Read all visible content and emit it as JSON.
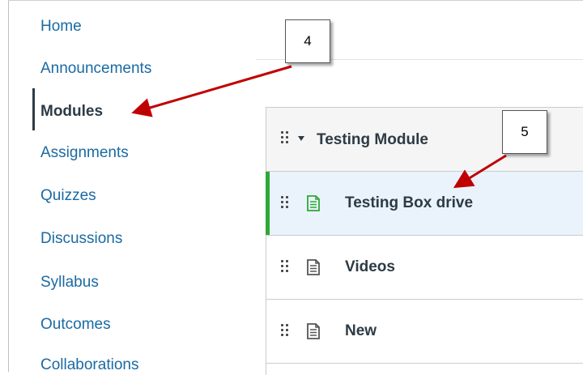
{
  "nav": {
    "items": [
      {
        "label": "Home"
      },
      {
        "label": "Announcements"
      },
      {
        "label": "Modules",
        "active": true
      },
      {
        "label": "Assignments"
      },
      {
        "label": "Quizzes"
      },
      {
        "label": "Discussions"
      },
      {
        "label": "Syllabus"
      },
      {
        "label": "Outcomes"
      },
      {
        "label": "Collaborations"
      }
    ]
  },
  "module": {
    "title": "Testing Module",
    "items": [
      {
        "label": "Testing Box drive",
        "icon": "page-icon",
        "selected": true,
        "icon_color": "#2ea836"
      },
      {
        "label": "Videos",
        "icon": "page-icon",
        "icon_color": "#555555"
      },
      {
        "label": "New",
        "icon": "page-icon",
        "icon_color": "#555555"
      }
    ]
  },
  "callouts": [
    {
      "number": "4"
    },
    {
      "number": "5"
    }
  ],
  "colors": {
    "link": "#1a6aa3",
    "active": "#2d3b45",
    "selected_bar": "#2ea836",
    "arrow": "#c00000"
  }
}
